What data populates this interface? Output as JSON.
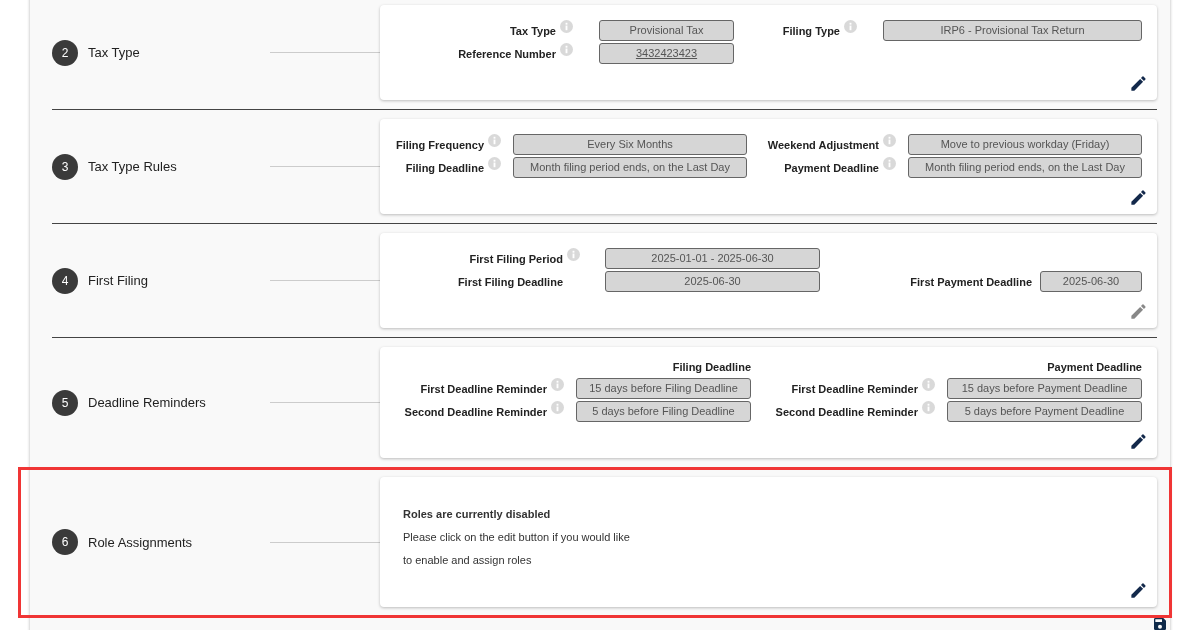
{
  "sections": [
    {
      "number": "2",
      "title": "Tax Type",
      "highlighted": false,
      "edit_enabled": true,
      "card": {
        "kind": "fields",
        "rows": [
          {
            "left": {
              "label": "Tax Type",
              "info": true,
              "value": "Provisional Tax",
              "underlined": false
            },
            "right": {
              "label": "Filing Type",
              "info": true,
              "value": "IRP6 - Provisional Tax Return",
              "underlined": false
            }
          },
          {
            "left": {
              "label": "Reference Number",
              "info": true,
              "value": "3432423423",
              "underlined": true
            }
          }
        ]
      }
    },
    {
      "number": "3",
      "title": "Tax Type Rules",
      "highlighted": false,
      "edit_enabled": true,
      "card": {
        "kind": "fields",
        "rows": [
          {
            "left": {
              "label": "Filing Frequency",
              "info": true,
              "value": "Every Six Months",
              "underlined": false
            },
            "right": {
              "label": "Weekend Adjustment",
              "info": true,
              "value": "Move to previous workday (Friday)",
              "underlined": false
            }
          },
          {
            "left": {
              "label": "Filing Deadline",
              "info": true,
              "value": "Month filing period ends, on the Last Day",
              "underlined": false
            },
            "right": {
              "label": "Payment Deadline",
              "info": true,
              "value": "Month filing period ends, on the Last Day",
              "underlined": false
            }
          }
        ]
      }
    },
    {
      "number": "4",
      "title": "First Filing",
      "highlighted": false,
      "edit_enabled": false,
      "card": {
        "kind": "fields",
        "rows": [
          {
            "left": {
              "label": "First Filing Period",
              "info": true,
              "value": "2025-01-01 - 2025-06-30",
              "underlined": false
            }
          },
          {
            "left": {
              "label": "First Filing Deadline",
              "info": false,
              "value": "2025-06-30",
              "underlined": false
            },
            "right": {
              "label": "First Payment Deadline",
              "info": false,
              "value": "2025-06-30",
              "underlined": false
            }
          }
        ]
      }
    },
    {
      "number": "5",
      "title": "Deadline Reminders",
      "highlighted": false,
      "edit_enabled": true,
      "card": {
        "kind": "fields",
        "headers": {
          "left": "Filing Deadline",
          "right": "Payment Deadline"
        },
        "rows": [
          {
            "left": {
              "label": "First Deadline Reminder",
              "info": true,
              "value": "15 days before Filing Deadline",
              "underlined": false
            },
            "right": {
              "label": "First Deadline Reminder",
              "info": true,
              "value": "15 days before Payment Deadline",
              "underlined": false
            }
          },
          {
            "left": {
              "label": "Second Deadline Reminder",
              "info": true,
              "value": "5 days before Filing Deadline",
              "underlined": false
            },
            "right": {
              "label": "Second Deadline Reminder",
              "info": true,
              "value": "5 days before Payment Deadline",
              "underlined": false
            }
          }
        ]
      }
    },
    {
      "number": "6",
      "title": "Role Assignments",
      "highlighted": true,
      "edit_enabled": true,
      "card": {
        "kind": "message",
        "heading": "Roles are currently disabled",
        "lines": [
          "Please click on the edit button if you would like",
          "to enable and assign roles"
        ]
      }
    }
  ]
}
